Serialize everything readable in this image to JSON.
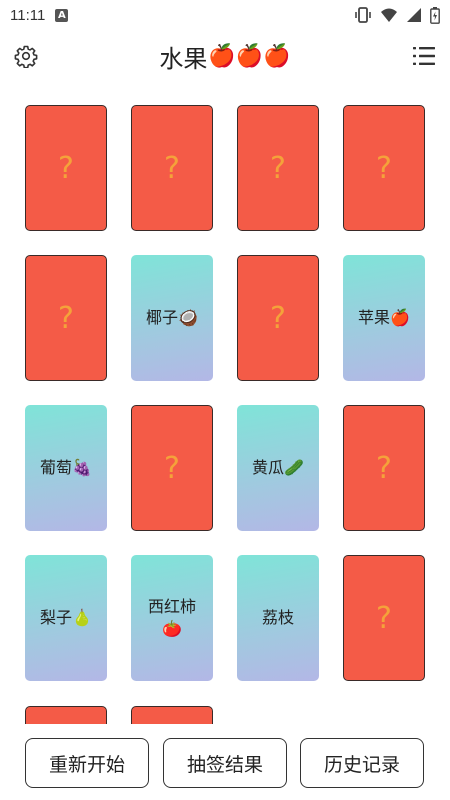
{
  "status_bar": {
    "time": "11:11",
    "notification_icon": "A"
  },
  "header": {
    "title": "水果",
    "title_emoji": "🍎🍎🍎"
  },
  "cards": [
    {
      "label": "?",
      "state": "hidden"
    },
    {
      "label": "?",
      "state": "hidden"
    },
    {
      "label": "?",
      "state": "hidden"
    },
    {
      "label": "?",
      "state": "hidden"
    },
    {
      "label": "?",
      "state": "hidden"
    },
    {
      "label": "椰子🥥",
      "state": "revealed"
    },
    {
      "label": "?",
      "state": "hidden"
    },
    {
      "label": "苹果🍎",
      "state": "revealed"
    },
    {
      "label": "葡萄🍇",
      "state": "revealed"
    },
    {
      "label": "?",
      "state": "hidden"
    },
    {
      "label": "黄瓜🥒",
      "state": "revealed"
    },
    {
      "label": "?",
      "state": "hidden"
    },
    {
      "label": "梨子🍐",
      "state": "revealed"
    },
    {
      "label": "西红柿🍅",
      "state": "revealed"
    },
    {
      "label": "荔枝",
      "state": "revealed"
    },
    {
      "label": "?",
      "state": "hidden"
    },
    {
      "label": "",
      "state": "hidden"
    },
    {
      "label": "",
      "state": "hidden"
    }
  ],
  "buttons": {
    "restart": "重新开始",
    "draw_result": "抽签结果",
    "history": "历史记录"
  },
  "colors": {
    "card_hidden": "#f45b47",
    "question_mark": "#f4a23a",
    "card_revealed_top": "#7fe4d8",
    "card_revealed_bottom": "#b3b7e6"
  },
  "icons": {
    "settings": "gear-icon",
    "menu": "list-menu-icon"
  }
}
